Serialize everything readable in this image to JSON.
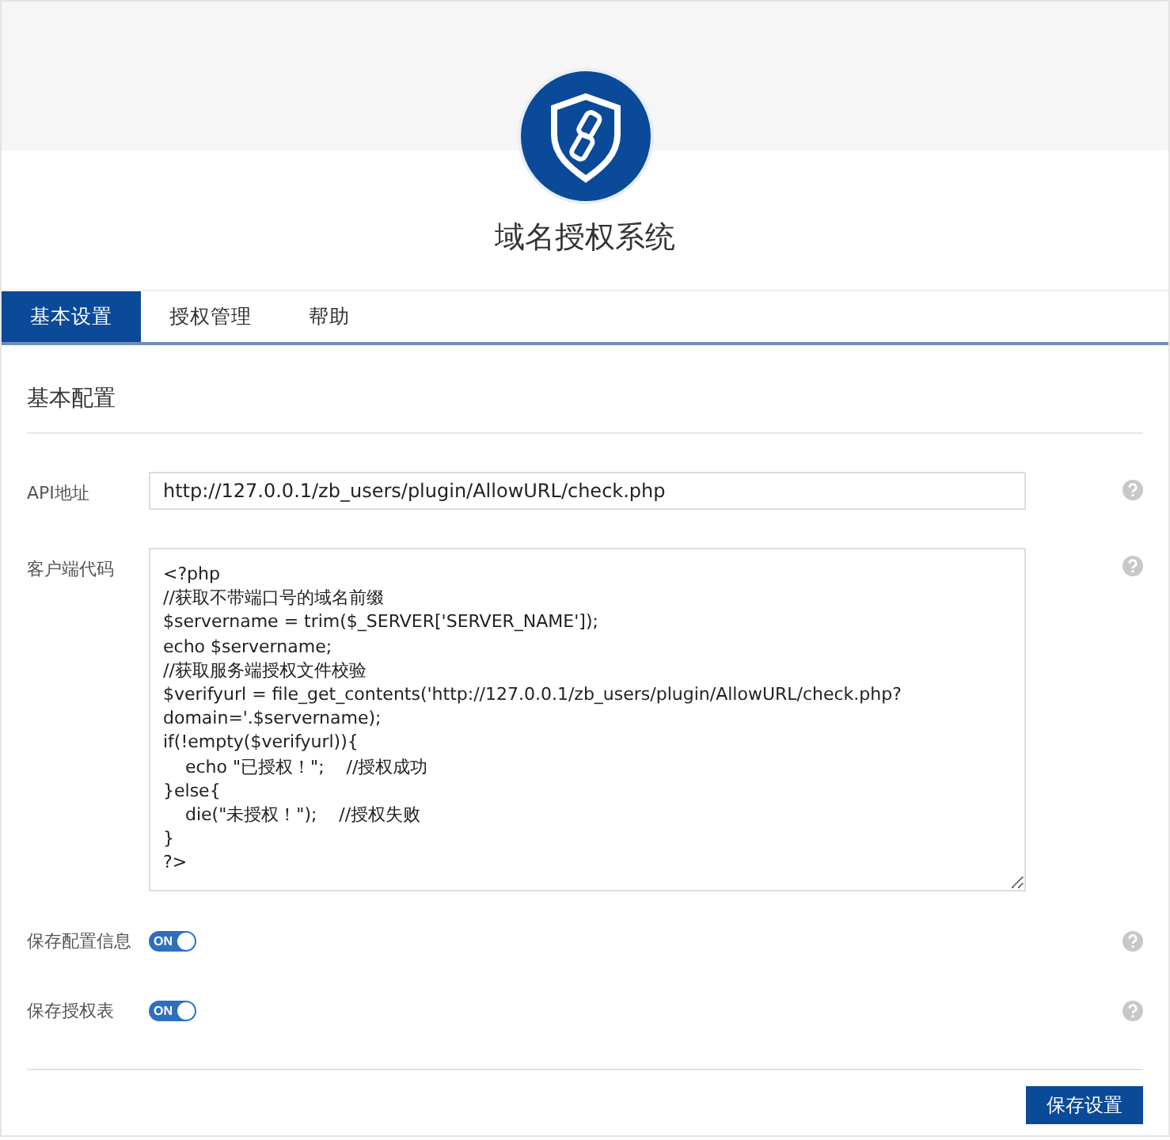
{
  "header": {
    "title": "域名授权系统"
  },
  "tabs": [
    {
      "label": "基本设置",
      "selected": true
    },
    {
      "label": "授权管理",
      "selected": false
    },
    {
      "label": "帮助",
      "selected": false
    }
  ],
  "section": {
    "title": "基本配置"
  },
  "fields": [
    {
      "kind": "input",
      "label": "API地址",
      "value": "http://127.0.0.1/zb_users/plugin/AllowURL/check.php"
    },
    {
      "kind": "textarea",
      "label": "客户端代码",
      "value": "<?php\n//获取不带端口号的域名前缀\n$servername = trim($_SERVER['SERVER_NAME']);\necho $servername;\n//获取服务端授权文件校验\n$verifyurl = file_get_contents('http://127.0.0.1/zb_users/plugin/AllowURL/check.php?\ndomain='.$servername);\nif(!empty($verifyurl)){\n    echo \"已授权！\";    //授权成功\n}else{\n    die(\"未授权！\");    //授权失败\n}\n?>"
    },
    {
      "kind": "switch",
      "label": "保存配置信息",
      "on": true,
      "switch_text": "ON"
    },
    {
      "kind": "switch",
      "label": "保存授权表",
      "on": true,
      "switch_text": "ON"
    }
  ],
  "save_button": "保存设置"
}
